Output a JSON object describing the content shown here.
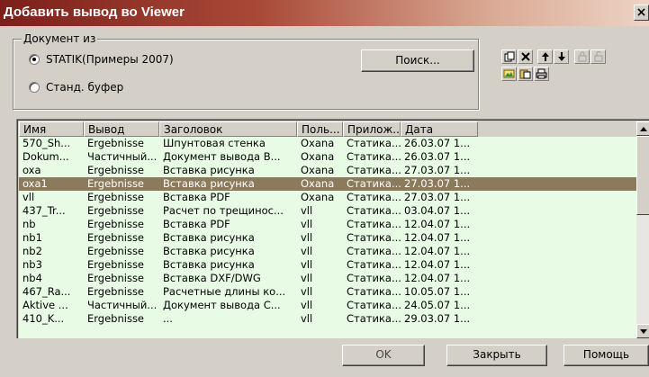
{
  "window": {
    "title": "Добавить вывод во Viewer",
    "close_label": "×"
  },
  "document_group": {
    "legend": "Документ из",
    "options": [
      {
        "label": "STATIK(Примеры 2007)",
        "checked": true
      },
      {
        "label": "Станд. буфер",
        "checked": false
      }
    ],
    "search_label": "Поиск..."
  },
  "toolbar": {
    "icons": [
      "copy-icon",
      "delete-icon",
      "move-up-icon",
      "move-down-icon",
      "lock-icon",
      "unlock-icon",
      "image-icon",
      "paste-icon",
      "print-icon"
    ]
  },
  "table": {
    "columns": [
      "Имя",
      "Вывод",
      "Заголовок",
      "Поль...",
      "Прилож...",
      "Дата"
    ],
    "rows": [
      [
        "570_Sh...",
        "Ergebnisse",
        "Шпунтовая стенка",
        "Oxana",
        "Статика...",
        "26.03.07 1..."
      ],
      [
        "Dokum...",
        "Частичный...",
        "Документ вывода В...",
        "Oxana",
        "Статика...",
        "26.03.07 1..."
      ],
      [
        "oxa",
        "Ergebnisse",
        "Вставка рисунка",
        "Oxana",
        "Статика...",
        "27.03.07 1..."
      ],
      [
        "oxa1",
        "Ergebnisse",
        "Вставка рисунка",
        "Oxana",
        "Статика...",
        "27.03.07 1..."
      ],
      [
        "vll",
        "Ergebnisse",
        "Вставка PDF",
        "Oxana",
        "Статика...",
        "27.03.07 1..."
      ],
      [
        "437_Tr...",
        "Ergebnisse",
        "Расчет по трещинос...",
        "vll",
        "Статика...",
        "03.04.07 1..."
      ],
      [
        "nb",
        "Ergebnisse",
        "Вставка PDF",
        "vll",
        "Статика...",
        "12.04.07 1..."
      ],
      [
        "nb1",
        "Ergebnisse",
        "Вставка рисунка",
        "vll",
        "Статика...",
        "12.04.07 1..."
      ],
      [
        "nb2",
        "Ergebnisse",
        "Вставка рисунка",
        "vll",
        "Статика...",
        "12.04.07 1..."
      ],
      [
        "nb3",
        "Ergebnisse",
        "Вставка рисунка",
        "vll",
        "Статика...",
        "12.04.07 1..."
      ],
      [
        "nb4",
        "Ergebnisse",
        "Вставка DXF/DWG",
        "vll",
        "Статика...",
        "12.04.07 1..."
      ],
      [
        "467_Ra...",
        "Ergebnisse",
        "Расчетные длины ко...",
        "vll",
        "Статика...",
        "10.05.07 1..."
      ],
      [
        "Aktive ...",
        "Частичный...",
        "Документ вывода С...",
        "vll",
        "Статика...",
        "24.05.07 1..."
      ],
      [
        "410_K...",
        "Ergebnisse",
        "...",
        "vll",
        "Статика...",
        "29.03.07 1..."
      ]
    ],
    "selected_index": 3
  },
  "footer": {
    "ok_label": "OK",
    "close_label": "Закрыть",
    "help_label": "Помощь"
  },
  "colors": {
    "list_background": "#e8fbe5",
    "selection": "#8c7a5c",
    "title_start": "#7c1f1a",
    "title_end": "#eed3c4"
  }
}
